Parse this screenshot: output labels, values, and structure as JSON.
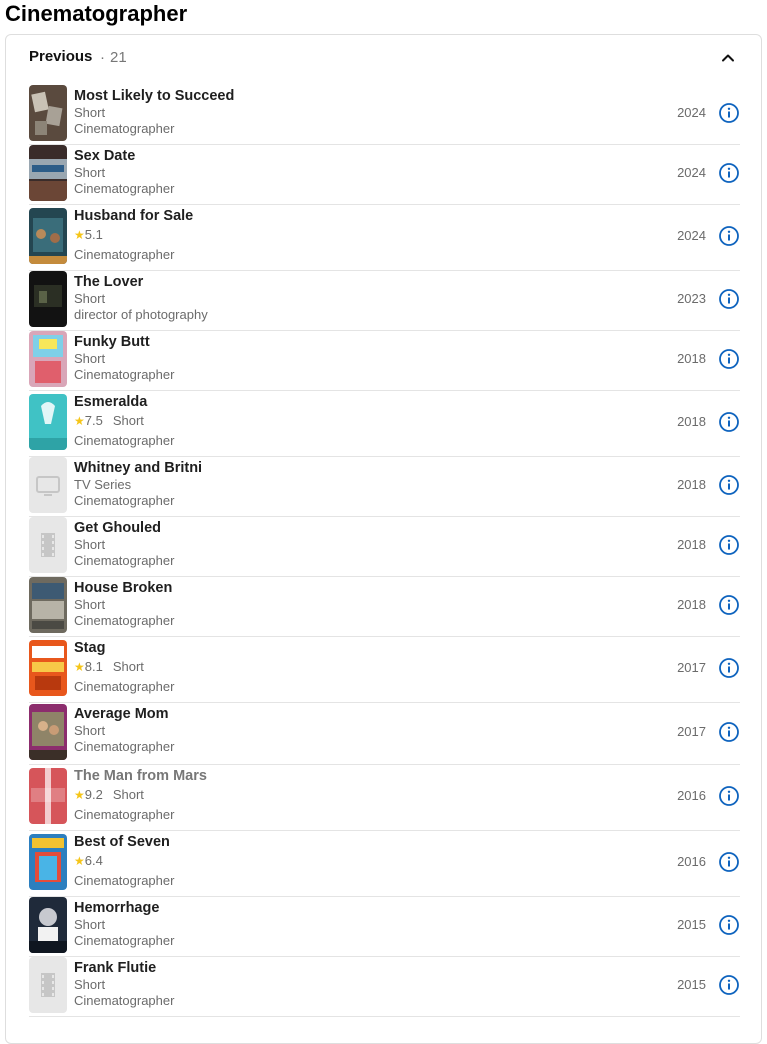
{
  "section": {
    "title": "Cinematographer"
  },
  "panel": {
    "heading": "Previous",
    "separator": "·",
    "count": "21",
    "collapse_icon": "chevron-up-icon"
  },
  "colors": {
    "accent_blue": "#0e63be",
    "star": "#f5c518",
    "muted_text": "#6b6b6b"
  },
  "credits": [
    {
      "title": "Most Likely to Succeed",
      "rating": "",
      "type": "Short",
      "role": "Cinematographer",
      "year": "2024",
      "poster": "poster-image"
    },
    {
      "title": "Sex Date",
      "rating": "",
      "type": "Short",
      "role": "Cinematographer",
      "year": "2024",
      "poster": "poster-image"
    },
    {
      "title": "Husband for Sale",
      "rating": "5.1",
      "type": "",
      "role": "Cinematographer",
      "year": "2024",
      "poster": "poster-image"
    },
    {
      "title": "The Lover",
      "rating": "",
      "type": "Short",
      "role": "director of photography",
      "year": "2023",
      "poster": "poster-image"
    },
    {
      "title": "Funky Butt",
      "rating": "",
      "type": "Short",
      "role": "Cinematographer",
      "year": "2018",
      "poster": "poster-image"
    },
    {
      "title": "Esmeralda",
      "rating": "7.5",
      "type": "Short",
      "role": "Cinematographer",
      "year": "2018",
      "poster": "poster-image"
    },
    {
      "title": "Whitney and Britni",
      "rating": "",
      "type": "TV Series",
      "role": "Cinematographer",
      "year": "2018",
      "poster": "tv-placeholder-icon"
    },
    {
      "title": "Get Ghouled",
      "rating": "",
      "type": "Short",
      "role": "Cinematographer",
      "year": "2018",
      "poster": "film-placeholder-icon"
    },
    {
      "title": "House Broken",
      "rating": "",
      "type": "Short",
      "role": "Cinematographer",
      "year": "2018",
      "poster": "poster-image"
    },
    {
      "title": "Stag",
      "rating": "8.1",
      "type": "Short",
      "role": "Cinematographer",
      "year": "2017",
      "poster": "poster-image"
    },
    {
      "title": "Average Mom",
      "rating": "",
      "type": "Short",
      "role": "Cinematographer",
      "year": "2017",
      "poster": "poster-image"
    },
    {
      "title": "The Man from Mars",
      "rating": "9.2",
      "type": "Short",
      "role": "Cinematographer",
      "year": "2016",
      "poster": "poster-image"
    },
    {
      "title": "Best of Seven",
      "rating": "6.4",
      "type": "",
      "role": "Cinematographer",
      "year": "2016",
      "poster": "poster-image"
    },
    {
      "title": "Hemorrhage",
      "rating": "",
      "type": "Short",
      "role": "Cinematographer",
      "year": "2015",
      "poster": "poster-image"
    },
    {
      "title": "Frank Flutie",
      "rating": "",
      "type": "Short",
      "role": "Cinematographer",
      "year": "2015",
      "poster": "film-placeholder-icon"
    }
  ]
}
